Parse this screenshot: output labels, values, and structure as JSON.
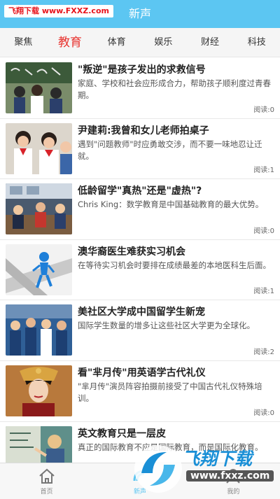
{
  "watermark_top": "飞翔下载 www.FXXZ.com",
  "app_title": "新声",
  "tabs": [
    "聚焦",
    "教育",
    "体育",
    "娱乐",
    "财经",
    "科技"
  ],
  "active_tab": "教育",
  "articles": [
    {
      "title": "\"叛逆\"是孩子发出的求救信号",
      "desc": "家庭、学校和社会应形成合力，帮助孩子顺利度过青春期。",
      "reads": "阅读:0"
    },
    {
      "title": "尹建莉:我曾和女儿老师拍桌子",
      "desc": "遇到\"问题教师\"时应勇敢交涉，而不要一味地忍让迁就。",
      "reads": "阅读:1"
    },
    {
      "title": "低龄留学\"真热\"还是\"虚热\"?",
      "desc": "Chris King：数学教育是中国基础教育的最大优势。",
      "reads": "阅读:0"
    },
    {
      "title": "澳华裔医生难获实习机会",
      "desc": "在等待实习机会时要排在成绩最差的本地医科生后面。",
      "reads": "阅读:1"
    },
    {
      "title": "美社区大学成中国留学生新宠",
      "desc": "国际学生数量的增多让这些社区大学更为全球化。",
      "reads": "阅读:2"
    },
    {
      "title": "看\"芈月传\"用英语学古代礼仪",
      "desc": "\"芈月传\"演员阵容拍摄前接受了中国古代礼仪特殊培训。",
      "reads": "阅读:0"
    },
    {
      "title": "英文教育只是一层皮",
      "desc": "真正的国际教育不应是国际教育，而是国际化教育。",
      "reads": ""
    }
  ],
  "bottom_nav": {
    "home": "首页",
    "news": "新声",
    "me": "我的"
  },
  "watermark_bottom": {
    "text": "飞翔下载",
    "url": "www.fxxz.com"
  },
  "colors": {
    "header": "#5cc6f2",
    "active_tab": "#e8322e",
    "watermark_red": "#e8141c"
  },
  "icons": {
    "home": "home-icon",
    "news": "news-icon",
    "me": "person-icon"
  }
}
